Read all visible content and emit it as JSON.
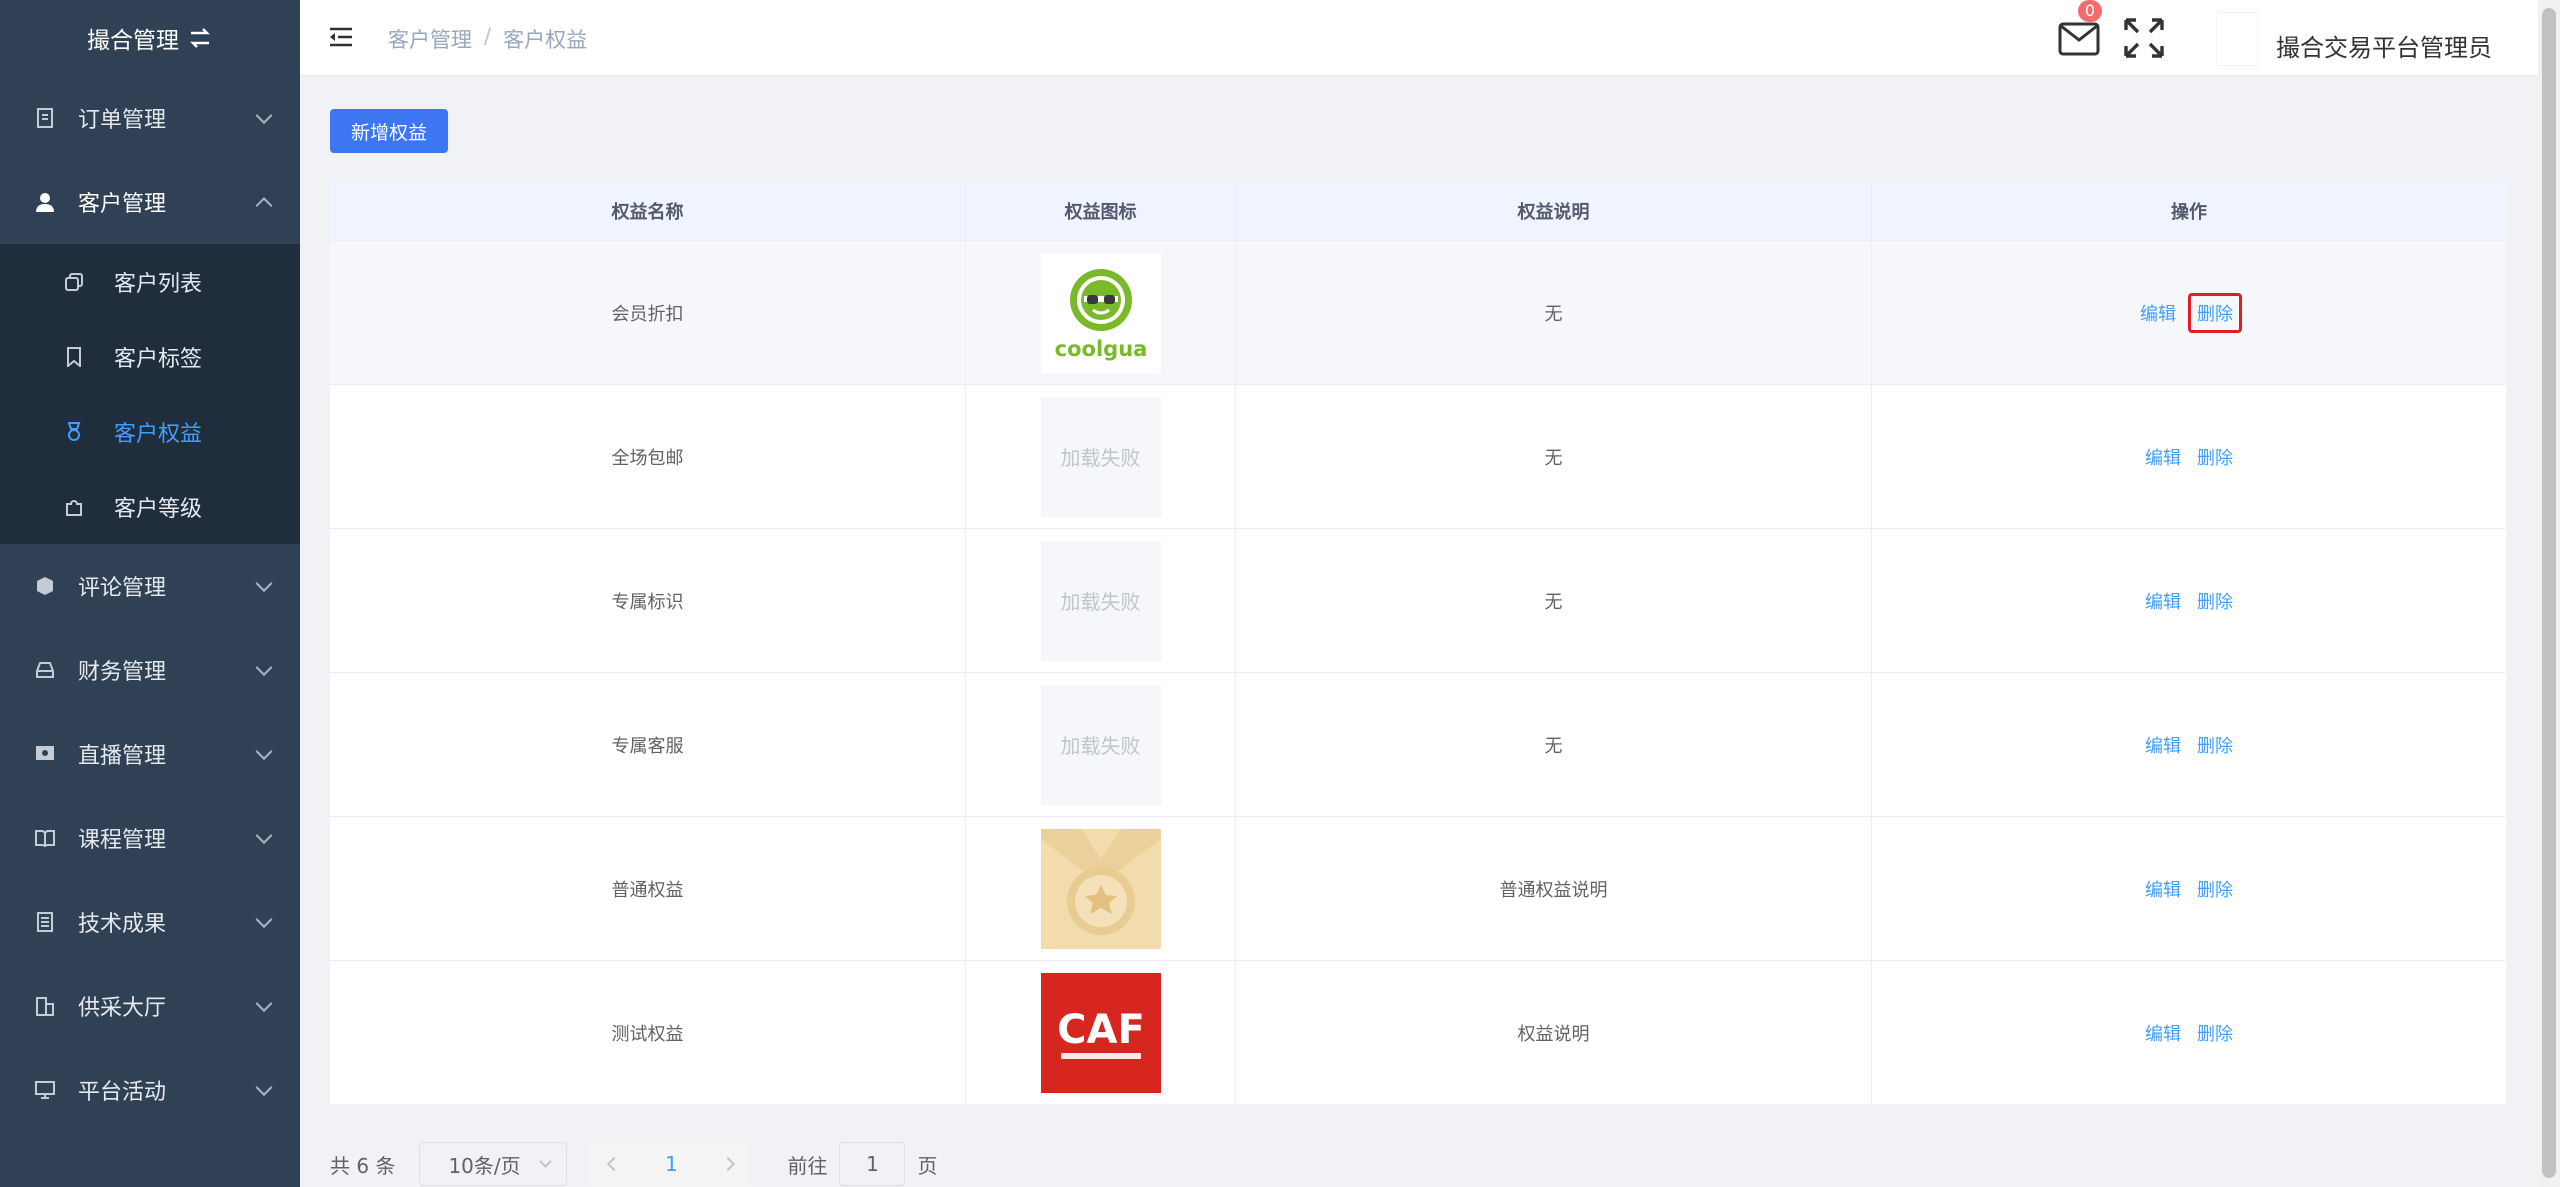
{
  "sidebar": {
    "title": "撮合管理",
    "items": [
      {
        "label": "订单管理",
        "icon": "document-icon"
      },
      {
        "label": "客户管理",
        "icon": "user-icon"
      },
      {
        "label": "评论管理",
        "icon": "comment-icon"
      },
      {
        "label": "财务管理",
        "icon": "finance-icon"
      },
      {
        "label": "直播管理",
        "icon": "live-icon"
      },
      {
        "label": "课程管理",
        "icon": "book-icon"
      },
      {
        "label": "技术成果",
        "icon": "list-icon"
      },
      {
        "label": "供采大厅",
        "icon": "building-icon"
      },
      {
        "label": "平台活动",
        "icon": "monitor-icon"
      }
    ],
    "sub_items": [
      {
        "label": "客户列表",
        "icon": "copy-icon"
      },
      {
        "label": "客户标签",
        "icon": "bookmark-icon"
      },
      {
        "label": "客户权益",
        "icon": "medal-icon"
      },
      {
        "label": "客户等级",
        "icon": "puzzle-icon"
      }
    ]
  },
  "header": {
    "breadcrumb": [
      "客户管理",
      "客户权益"
    ],
    "separator": "/",
    "message_count": "0",
    "username": "撮合交易平台管理员"
  },
  "toolbar": {
    "add_label": "新增权益"
  },
  "table": {
    "columns": [
      "权益名称",
      "权益图标",
      "权益说明",
      "操作"
    ],
    "rows": [
      {
        "name": "会员折扣",
        "icon": "coolgua",
        "icon_text": "coolgua",
        "desc": "无"
      },
      {
        "name": "全场包邮",
        "icon": "fail",
        "icon_text": "加载失败",
        "desc": "无"
      },
      {
        "name": "专属标识",
        "icon": "fail",
        "icon_text": "加载失败",
        "desc": "无"
      },
      {
        "name": "专属客服",
        "icon": "fail",
        "icon_text": "加载失败",
        "desc": "无"
      },
      {
        "name": "普通权益",
        "icon": "medal",
        "icon_text": "",
        "desc": "普通权益说明"
      },
      {
        "name": "测试权益",
        "icon": "caf",
        "icon_text": "CAF",
        "desc": "权益说明"
      }
    ],
    "edit_label": "编辑",
    "delete_label": "删除"
  },
  "pagination": {
    "total": "共 6 条",
    "page_size": "10条/页",
    "current_page": "1",
    "goto_label": "前往",
    "goto_value": "1",
    "page_unit": "页"
  },
  "colors": {
    "sidebar_bg": "#304156",
    "accent": "#409eff",
    "primary_btn": "#3c76f0",
    "badge": "#f56c6c"
  }
}
